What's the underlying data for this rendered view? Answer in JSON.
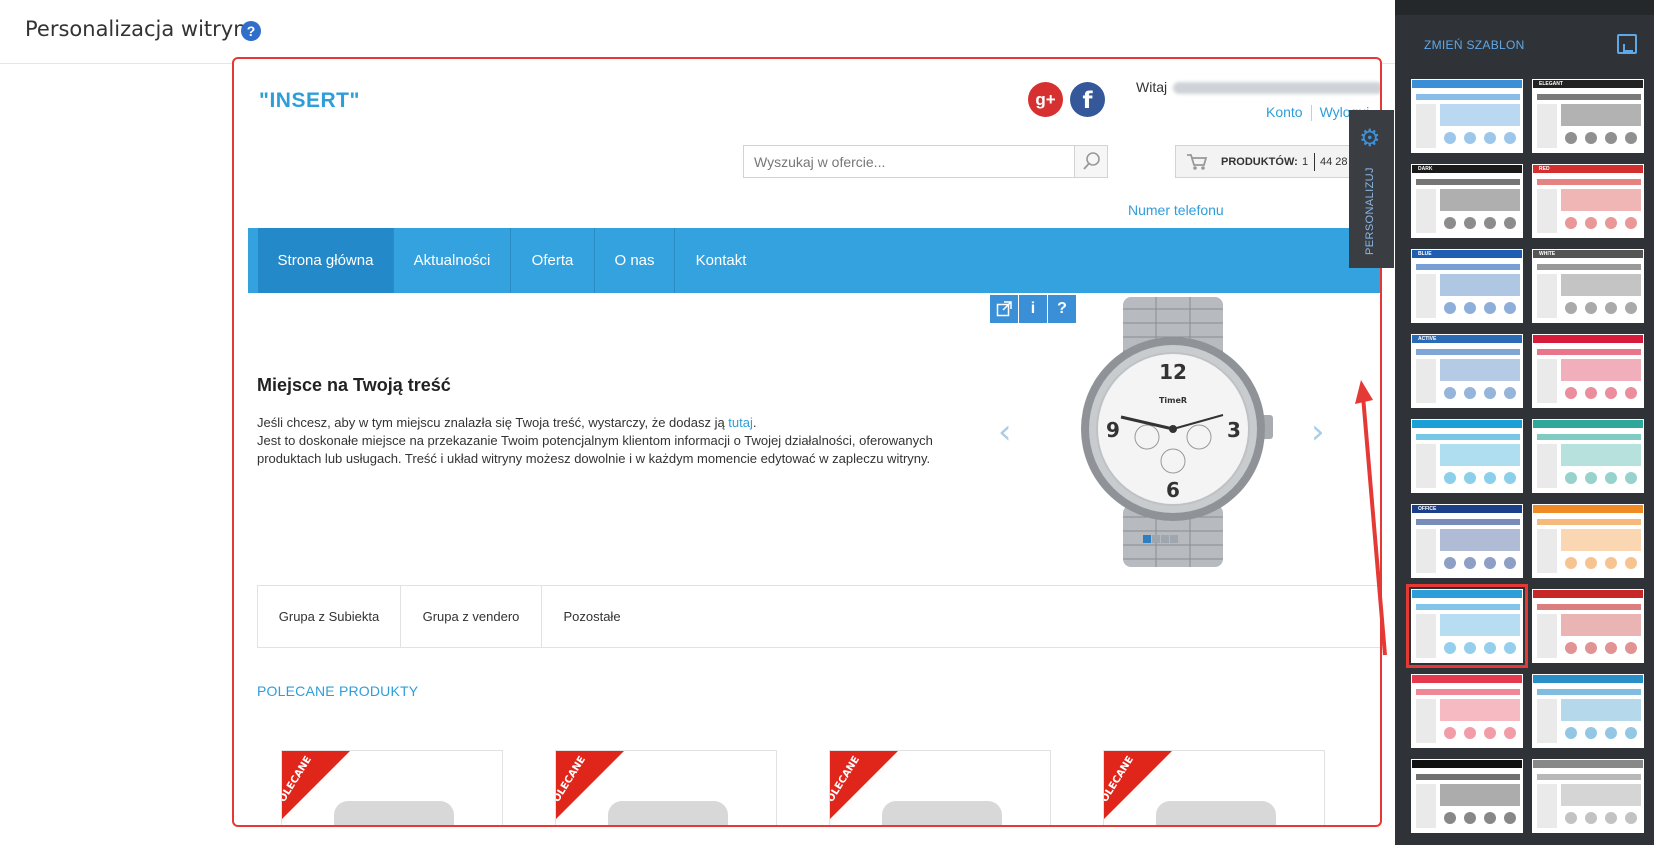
{
  "page": {
    "title": "Personalizacja witryny",
    "help_icon": "?"
  },
  "store": {
    "logo": "\"INSERT\"",
    "social": {
      "gplus": "g+",
      "facebook": "f"
    },
    "greeting": "Witaj",
    "account_link": "Konto",
    "logout_link": "Wyloguj",
    "search_placeholder": "Wyszukaj w ofercie...",
    "cart_label": "PRODUKTÓW:",
    "cart_count": "1",
    "cart_total": "44 28",
    "phone": "Numer telefonu",
    "nav": [
      "Strona główna",
      "Aktualności",
      "Oferta",
      "O nas",
      "Kontakt"
    ],
    "slide": {
      "title": "Miejsce na Twoją treść",
      "text_before_link": "Jeśli chcesz, aby w tym miejscu znalazła się Twoja treść, wystarczy, że dodasz ją ",
      "link": "tutaj",
      "text_after_link": ".",
      "text_line2": "Jest to doskonałe miejsce na przekazanie Twoim potencjalnym klientom informacji o Twojej działalności, oferowanych produktach lub usługach. Treść i układ witryny możesz dowolnie i w każdym momencie edytować w zapleczu witryny.",
      "prev_arrow": "‹",
      "next_arrow": "›"
    },
    "watch_brand": "TimeR",
    "watch_numbers": [
      "12",
      "3",
      "6",
      "9"
    ],
    "tabs": [
      "Grupa z Subiekta",
      "Grupa z vendero",
      "Pozostałe"
    ],
    "section_title": "POLECANE PRODUKTY",
    "ribbon_label": "POLECANE"
  },
  "personalize_tab": {
    "label": "PERSONALIZUJ"
  },
  "sidebar": {
    "title": "ZMIEŃ SZABLON",
    "templates": [
      {
        "label": "",
        "accent": "#3a8fd6"
      },
      {
        "label": "ELEGANT",
        "accent": "#222222"
      },
      {
        "label": "DARK",
        "accent": "#1a1a1a"
      },
      {
        "label": "RED",
        "accent": "#d32f2f"
      },
      {
        "label": "BLUE",
        "accent": "#1e5fb3"
      },
      {
        "label": "WHITE",
        "accent": "#555555"
      },
      {
        "label": "ACTIVE",
        "accent": "#2b6bb5"
      },
      {
        "label": "",
        "accent": "#d81b3c"
      },
      {
        "label": "",
        "accent": "#1aa0d6"
      },
      {
        "label": "",
        "accent": "#2fa89a"
      },
      {
        "label": "OFFICE",
        "accent": "#1c3f8a"
      },
      {
        "label": "",
        "accent": "#f08a24"
      },
      {
        "label": "",
        "accent": "#2e9edb"
      },
      {
        "label": "",
        "accent": "#c62828"
      },
      {
        "label": "",
        "accent": "#e53950"
      },
      {
        "label": "",
        "accent": "#2a8fc7"
      },
      {
        "label": "",
        "accent": "#111111"
      },
      {
        "label": "",
        "accent": "#888888"
      }
    ],
    "selected_index": 12
  }
}
